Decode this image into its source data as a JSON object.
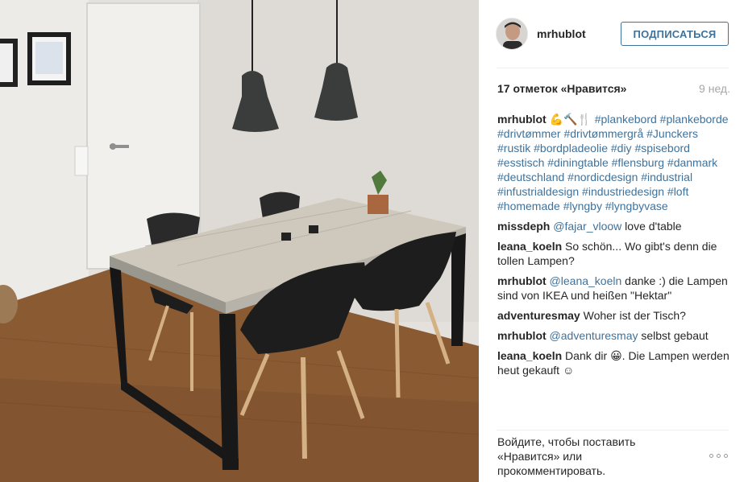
{
  "post": {
    "username": "mrhublot",
    "follow_label": "ПОДПИСАТЬСЯ",
    "likes": "17 отметок «Нравится»",
    "age": "9 нед."
  },
  "caption": {
    "user": "mrhublot",
    "emoji": "💪🔨🍴",
    "text": "#plankebord #plankeborde #drivtømmer #drivtømmergrå #Junckers #rustik #bordpladeolie #diy #spisebord #esstisch #diningtable #flensburg #danmark #deutschland #nordicdesign #industrial #infustrialdesign #industriedesign #loft #homemade #lyngby #lyngbyvase"
  },
  "comments": [
    {
      "user": "missdeph",
      "mention": "@fajar_vloow",
      "text": " love d'table"
    },
    {
      "user": "leana_koeln",
      "mention": "",
      "text": "So schön... Wo gibt's denn die tollen Lampen?"
    },
    {
      "user": "mrhublot",
      "mention": "@leana_koeln",
      "text": " danke :) die Lampen sind von IKEA und heißen \"Hektar\""
    },
    {
      "user": "adventuresmay",
      "mention": "",
      "text": "Woher ist der Tisch?"
    },
    {
      "user": "mrhublot",
      "mention": "@adventuresmay",
      "text": " selbst gebaut"
    },
    {
      "user": "leana_koeln",
      "mention": "",
      "text": "Dank dir 😀. Die Lampen werden heut gekauft ☺"
    }
  ],
  "footer": {
    "login_prompt": "Войдите, чтобы поставить «Нравится» или прокомментировать.",
    "more_icon": "more-options-icon"
  },
  "colors": {
    "link": "#3f729b",
    "text": "#262626",
    "muted": "#a5a7aa"
  }
}
